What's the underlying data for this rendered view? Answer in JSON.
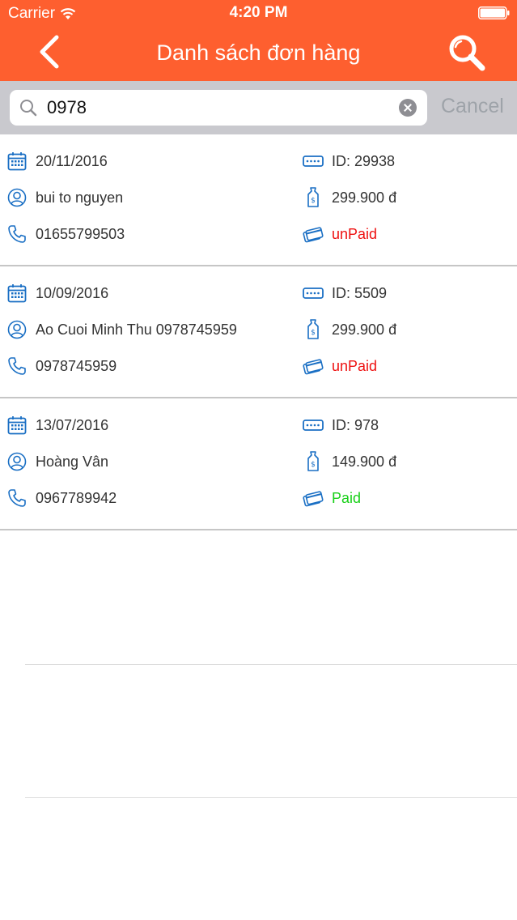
{
  "status_bar": {
    "carrier": "Carrier",
    "time": "4:20 PM"
  },
  "navbar": {
    "title": "Danh sách đơn hàng"
  },
  "search": {
    "value": "0978",
    "cancel_label": "Cancel"
  },
  "colors": {
    "accent": "#fe5f2f",
    "icon": "#1a6fc4",
    "unpaid": "#ee1111",
    "paid": "#19d019"
  },
  "orders": [
    {
      "date": "20/11/2016",
      "id": "ID: 29938",
      "name": "bui to nguyen",
      "price": "299.900 đ",
      "phone": "01655799503",
      "status": "unPaid"
    },
    {
      "date": "10/09/2016",
      "id": "ID: 5509",
      "name": "Ao Cuoi Minh Thu 0978745959",
      "price": "299.900 đ",
      "phone": "0978745959",
      "status": "unPaid"
    },
    {
      "date": "13/07/2016",
      "id": "ID: 978",
      "name": "Hoàng Vân",
      "price": "149.900 đ",
      "phone": "0967789942",
      "status": "Paid"
    }
  ]
}
